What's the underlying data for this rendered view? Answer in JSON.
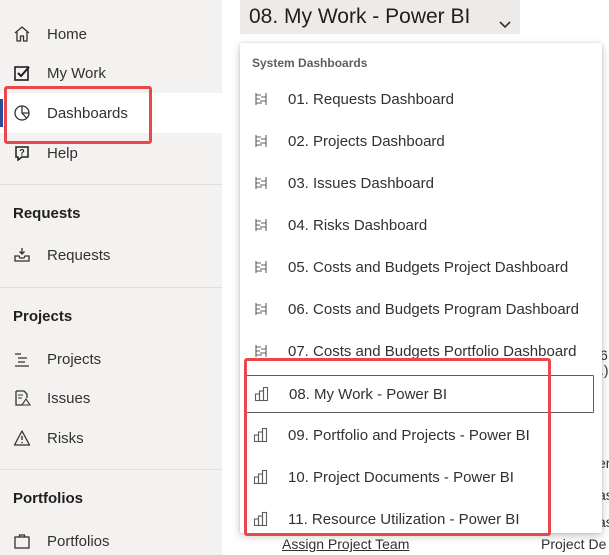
{
  "sidebar": {
    "items": [
      {
        "label": "Home",
        "icon": "home-icon"
      },
      {
        "label": "My Work",
        "icon": "checkbox-icon"
      },
      {
        "label": "Dashboards",
        "icon": "pie-chart-icon"
      },
      {
        "label": "Help",
        "icon": "help-icon"
      }
    ],
    "sections": [
      {
        "title": "Requests",
        "items": [
          {
            "label": "Requests",
            "icon": "inbox-icon"
          }
        ]
      },
      {
        "title": "Projects",
        "items": [
          {
            "label": "Projects",
            "icon": "task-list-icon"
          },
          {
            "label": "Issues",
            "icon": "issue-icon"
          },
          {
            "label": "Risks",
            "icon": "warning-icon"
          }
        ]
      },
      {
        "title": "Portfolios",
        "items": [
          {
            "label": "Portfolios",
            "icon": "portfolio-icon"
          }
        ]
      }
    ]
  },
  "header": {
    "title": "08. My Work - Power BI"
  },
  "background": {
    "fragment_1": "6",
    "fragment_2": ".)",
    "fragment_3": "er",
    "fragment_4": "as",
    "fragment_5": "as",
    "link": "Assign Project Team",
    "column_text": "Project De"
  },
  "dropdown": {
    "header": "System Dashboards",
    "items": [
      {
        "label": "01. Requests Dashboard",
        "icon": "dashboard-icon"
      },
      {
        "label": "02. Projects Dashboard",
        "icon": "dashboard-icon"
      },
      {
        "label": "03. Issues Dashboard",
        "icon": "dashboard-icon"
      },
      {
        "label": "04. Risks Dashboard",
        "icon": "dashboard-icon"
      },
      {
        "label": "05. Costs and Budgets Project Dashboard",
        "icon": "dashboard-icon"
      },
      {
        "label": "06. Costs and Budgets Program Dashboard",
        "icon": "dashboard-icon"
      },
      {
        "label": "07. Costs and Budgets Portfolio Dashboard",
        "icon": "dashboard-icon"
      },
      {
        "label": "08. My Work - Power BI",
        "icon": "power-bi-icon"
      },
      {
        "label": "09. Portfolio and Projects - Power BI",
        "icon": "power-bi-icon"
      },
      {
        "label": "10. Project Documents - Power BI",
        "icon": "power-bi-icon"
      },
      {
        "label": "11. Resource Utilization - Power BI",
        "icon": "power-bi-icon"
      }
    ]
  },
  "colors": {
    "highlight": "#e8474b",
    "sidebar_bg": "#f3f2f1",
    "accent": "#2b4c9c"
  }
}
